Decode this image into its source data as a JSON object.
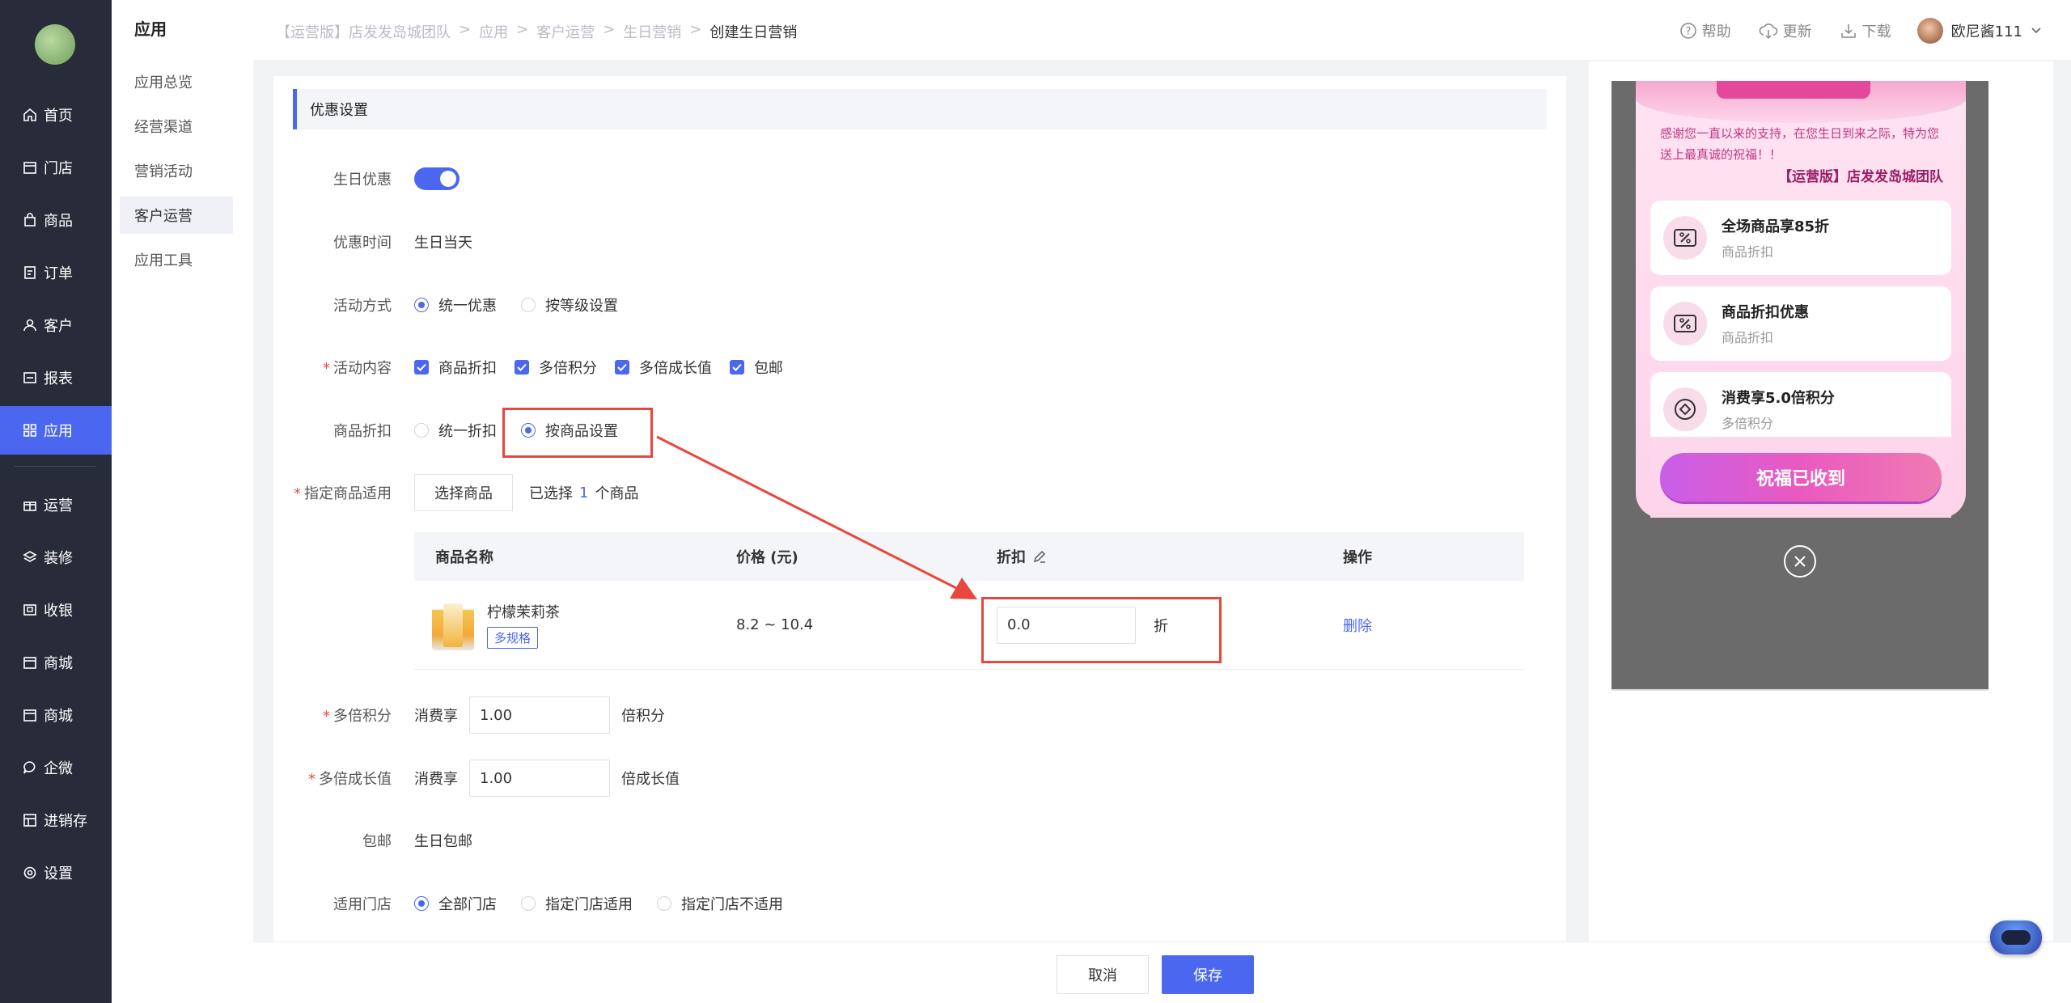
{
  "nav": {
    "items": [
      {
        "label": "首页",
        "icon": "home-icon"
      },
      {
        "label": "门店",
        "icon": "store-icon"
      },
      {
        "label": "商品",
        "icon": "bag-icon"
      },
      {
        "label": "订单",
        "icon": "order-icon"
      },
      {
        "label": "客户",
        "icon": "user-icon"
      },
      {
        "label": "报表",
        "icon": "report-icon"
      },
      {
        "label": "应用",
        "icon": "apps-icon"
      },
      {
        "label": "运营",
        "icon": "gift-icon"
      },
      {
        "label": "装修",
        "icon": "layers-icon"
      },
      {
        "label": "收银",
        "icon": "cashier-icon"
      },
      {
        "label": "商城",
        "icon": "mall-icon"
      },
      {
        "label": "商城",
        "icon": "mall-icon"
      },
      {
        "label": "企微",
        "icon": "chat-icon"
      },
      {
        "label": "进销存",
        "icon": "inventory-icon"
      },
      {
        "label": "设置",
        "icon": "gear-icon"
      }
    ],
    "active_index": 6
  },
  "submenu": {
    "title": "应用",
    "items": [
      "应用总览",
      "经营渠道",
      "营销活动",
      "客户运营",
      "应用工具"
    ],
    "active_index": 3
  },
  "breadcrumb": [
    "【运营版】店发发岛城团队",
    "应用",
    "客户运营",
    "生日营销",
    "创建生日营销"
  ],
  "topbar": {
    "help": "帮助",
    "update": "更新",
    "download": "下载",
    "username": "欧尼酱111"
  },
  "form": {
    "section_title": "优惠设置",
    "birthday_discount": {
      "label": "生日优惠",
      "enabled": true
    },
    "discount_time": {
      "label": "优惠时间",
      "value": "生日当天"
    },
    "activity_mode": {
      "label": "活动方式",
      "options": [
        "统一优惠",
        "按等级设置"
      ],
      "selected": 0
    },
    "activity_content": {
      "label": "活动内容",
      "options": [
        "商品折扣",
        "多倍积分",
        "多倍成长值",
        "包邮"
      ]
    },
    "product_discount": {
      "label": "商品折扣",
      "options": [
        "统一折扣",
        "按商品设置"
      ],
      "selected": 1
    },
    "specified_products": {
      "label": "指定商品适用",
      "button": "选择商品",
      "selected_prefix": "已选择",
      "selected_count": "1",
      "selected_suffix": "个商品"
    },
    "table": {
      "headers": [
        "商品名称",
        "价格 (元)",
        "折扣",
        "操作"
      ],
      "rows": [
        {
          "name": "柠檬茉莉茶",
          "tag": "多规格",
          "price": "8.2 ~ 10.4",
          "discount": "0.0",
          "discount_unit": "折",
          "action": "删除"
        }
      ]
    },
    "multi_points": {
      "label": "多倍积分",
      "prefix": "消费享",
      "value": "1.00",
      "suffix": "倍积分"
    },
    "multi_growth": {
      "label": "多倍成长值",
      "prefix": "消费享",
      "value": "1.00",
      "suffix": "倍成长值"
    },
    "free_shipping": {
      "label": "包邮",
      "value": "生日包邮"
    },
    "stores": {
      "label": "适用门店",
      "options": [
        "全部门店",
        "指定门店适用",
        "指定门店不适用"
      ],
      "selected": 0
    }
  },
  "footer": {
    "cancel": "取消",
    "save": "保存"
  },
  "preview": {
    "message": "感谢您一直以来的支持，在您生日到来之际，特为您送上最真诚的祝福！！",
    "team": "【运营版】店发发岛城团队",
    "coupons": [
      {
        "title": "全场商品享85折",
        "sub": "商品折扣"
      },
      {
        "title": "商品折扣优惠",
        "sub": "商品折扣"
      },
      {
        "title": "消费享5.0倍积分",
        "sub": "多倍积分"
      }
    ],
    "cta": "祝福已收到"
  },
  "colors": {
    "primary": "#4b67f0",
    "nav_bg": "#282c3a",
    "highlight": "#e8473d",
    "required": "#f0493f"
  }
}
